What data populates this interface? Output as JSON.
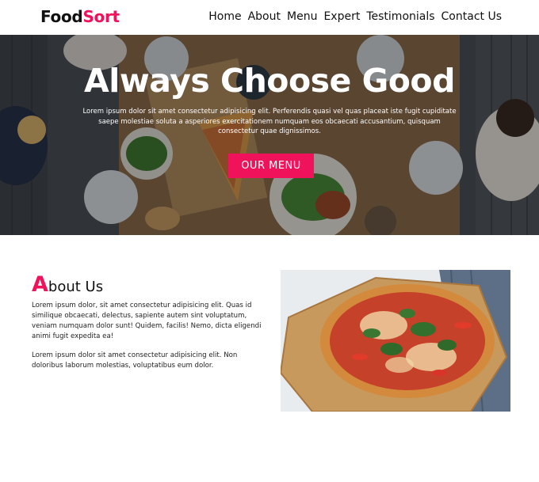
{
  "header": {
    "logo_part1": "Food",
    "logo_part2": "Sort",
    "nav": [
      "Home",
      "About",
      "Menu",
      "Expert",
      "Testimonials",
      "Contact Us"
    ]
  },
  "hero": {
    "title": "Always Choose Good",
    "text": "Lorem ipsum dolor sit amet consectetur adipisicing elit. Perferendis quasi vel quas placeat iste fugit cupiditate saepe molestiae soluta a asperiores exercitationem numquam eos obcaecati accusantium, quisquam consectetur quae dignissimos.",
    "button_label": "OUR MENU"
  },
  "about": {
    "title_first_letter": "A",
    "title_rest": "bout Us",
    "paragraph1": "Lorem ipsum dolor, sit amet consectetur adipisicing elit. Quas id similique obcaecati, delectus, sapiente autem sint voluptatum, veniam numquam dolor sunt! Quidem, facilis! Nemo, dicta eligendi animi fugit expedita ea!",
    "paragraph2": "Lorem ipsum dolor sit amet consectetur adipisicing elit. Non doloribus laborum molestias, voluptatibus eum dolor."
  },
  "colors": {
    "accent": "#f0135c",
    "text": "#111111"
  }
}
